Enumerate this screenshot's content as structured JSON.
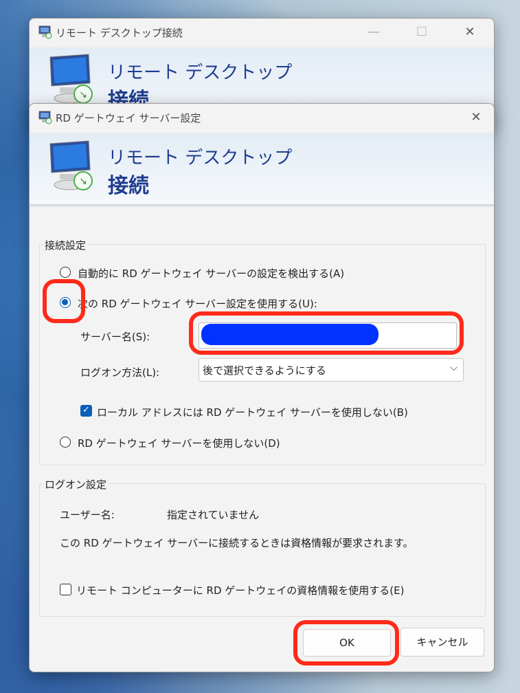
{
  "back_window": {
    "title": "リモート デスクトップ接続",
    "banner_line1": "リモート デスクトップ",
    "banner_line2": "接続",
    "minimize_glyph": "—",
    "maximize_glyph": "☐",
    "close_glyph": "✕"
  },
  "dialog": {
    "title": "RD ゲートウェイ サーバー設定",
    "close_glyph": "✕",
    "banner_line1": "リモート デスクトップ",
    "banner_line2": "接続",
    "connection_group": {
      "label": "接続設定",
      "radio_auto": "自動的に RD ゲートウェイ サーバーの設定を検出する(A)",
      "radio_use": "次の RD ゲートウェイ サーバー設定を使用する(U):",
      "server_name_label": "サーバー名(S):",
      "server_name_value": "",
      "logon_method_label": "ログオン方法(L):",
      "logon_method_value": "後で選択できるようにする",
      "bypass_local_label": "ローカル アドレスには RD ゲートウェイ サーバーを使用しない(B)",
      "bypass_local_checked": true,
      "radio_none": "RD ゲートウェイ サーバーを使用しない(D)",
      "selected_radio": "use"
    },
    "logon_group": {
      "label": "ログオン設定",
      "username_label": "ユーザー名:",
      "username_value": "指定されていません",
      "info_text": "この RD ゲートウェイ サーバーに接続するときは資格情報が要求されます。",
      "use_credentials_label": "リモート コンピューターに RD ゲートウェイの資格情報を使用する(E)",
      "use_credentials_checked": false
    },
    "ok_label": "OK",
    "cancel_label": "キャンセル"
  },
  "colors": {
    "accent": "#0a5db8",
    "highlight": "#ff2a1a",
    "redaction": "#0033ff",
    "banner_text": "#1f3d8f"
  }
}
